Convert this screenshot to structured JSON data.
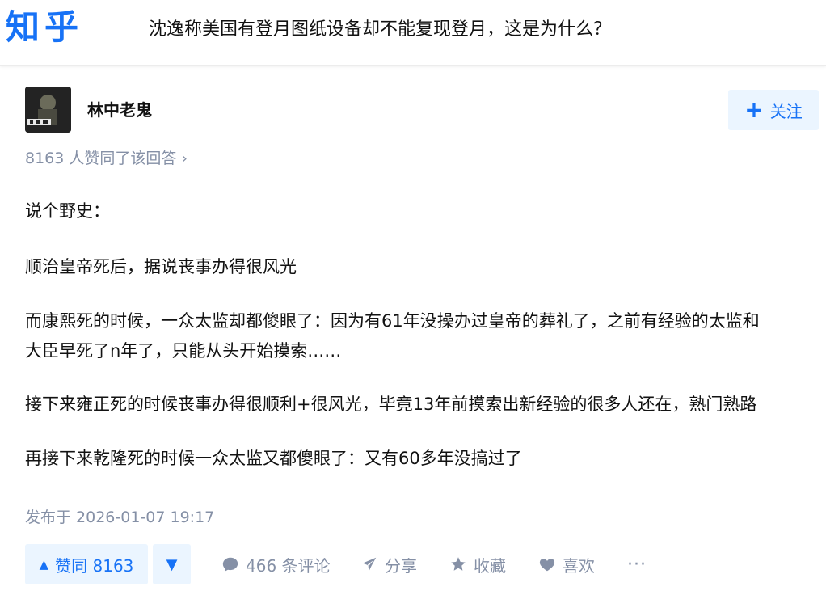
{
  "header": {
    "logo_text": "知乎",
    "question_title": "沈逸称美国有登月图纸设备却不能复现登月，这是为什么？"
  },
  "author": {
    "name": "林中老鬼",
    "follow_label": "关注"
  },
  "answer": {
    "upvote_summary": "8163 人赞同了该回答",
    "paragraphs": {
      "p1": "说个野史：",
      "p2": "顺治皇帝死后，据说丧事办得很风光",
      "p3_a": "而康熙死的时候，一众太监却都傻眼了：",
      "p3_link": "因为有61年没操办过皇帝的葬礼了",
      "p3_b": "，之前有经验的太监和",
      "p3_c": "大臣早死了n年了，只能从头开始摸索……",
      "p4": "接下来雍正死的时候丧事办得很顺利+很风光，毕竟13年前摸索出新经验的很多人还在，熟门熟路",
      "p5": "再接下来乾隆死的时候一众太监又都傻眼了：又有60多年没搞过了"
    },
    "publish_time": "发布于 2026-01-07 19:17"
  },
  "actions": {
    "vote_up_label": "赞同 8163",
    "comment_label": "466 条评论",
    "share_label": "分享",
    "collect_label": "收藏",
    "like_label": "喜欢",
    "more_label": "···"
  },
  "colors": {
    "brand": "#1772f6",
    "muted": "#8590a6",
    "vote_bg": "#ebf5ff"
  }
}
